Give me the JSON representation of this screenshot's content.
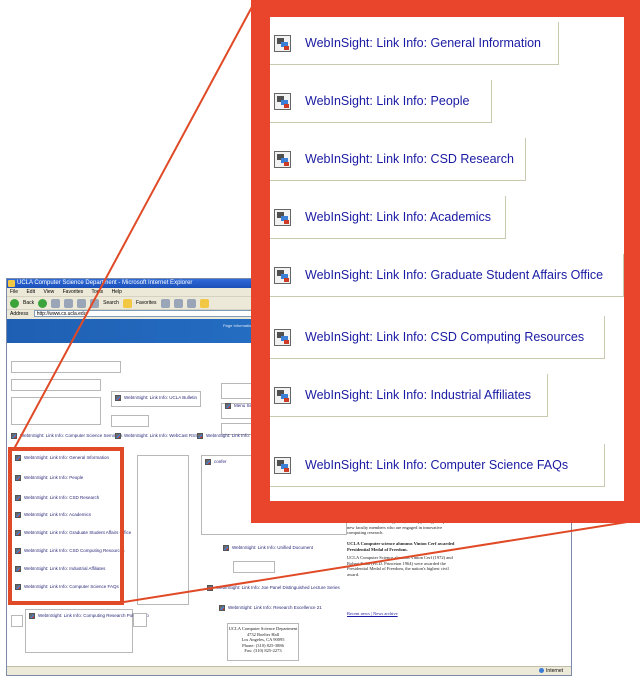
{
  "browser": {
    "title": "UCLA Computer Science Department - Microsoft Internet Explorer",
    "menu": [
      "File",
      "Edit",
      "View",
      "Favorites",
      "Tools",
      "Help"
    ],
    "toolbar": {
      "back": "Back",
      "search": "Search",
      "favorites": "Favorites"
    },
    "address_label": "Address",
    "address": "http://www.cs.ucla.edu/",
    "status_zone": "Internet"
  },
  "page": {
    "header_text": "Page Information / Global Site Information",
    "top_links": [
      "WebInSight: Link Info: UCLA Bulletin",
      "WebInSight: Link Info: Computer Science Seminars",
      "WebInSight: Link Info: WebCast RSS",
      "WebInSight: Link Info: CSD"
    ],
    "left_links": [
      "WebInSight: Link Info: General Information",
      "WebInSight: Link Info: People",
      "WebInSight: Link Info: CSD Research",
      "WebInSight: Link Info: Academics",
      "WebInSight: Link Info: Graduate Student Affairs Office",
      "WebInSight: Link Info: CSD Computing Resources",
      "WebInSight: Link Info: Industrial Affiliates",
      "WebInSight: Link Info: Computer Science FAQs"
    ],
    "bottom_link": "WebInSight: Link Info: Computing Research Policy Map",
    "center_links": [
      "WebInSight: Link Info: Unified Document",
      "WebInSight: Link Info: Joe Panel Distinguished Lecture Series",
      "WebInSight: Link Info: Research Excellence 21"
    ],
    "news_text": "Microsoft scientists, recognized, and supporting exceptional new faculty members who are engaged in innovative computing research.",
    "news_headline": "UCLA Computer science alumnus Vinton Cerf awarded Presidential Medal of Freedom.",
    "news_body": "UCLA Computer Science alumnus Vinton Cerf (1972) and Robert Kahn (Ph.D. Princeton 1964) were awarded the Presidential Medal of Freedom, the nation's highest civil award.",
    "news_links": "Recent news | News archive",
    "address_block": [
      "UCLA Computer Science Department",
      "4732 Boelter Hall",
      "Los Angeles, CA 90095",
      "Phone: (310) 825-3886",
      "Fax: (310) 825-2273"
    ],
    "misc_labels": [
      "Menu Search",
      "confer"
    ]
  },
  "zoom": {
    "links": [
      "WebInSight: Link Info: General Information",
      "WebInSight: Link Info: People",
      "WebInSight: Link Info: CSD Research",
      "WebInSight: Link Info: Academics",
      "WebInSight: Link Info: Graduate Student Affairs Office",
      "WebInSight: Link Info: CSD Computing Resources",
      "WebInSight: Link Info: Industrial Affiliates",
      "WebInSight: Link Info: Computer Science FAQs"
    ]
  },
  "colors": {
    "callout_red": "#e9442c",
    "link_blue": "#1a1aa3",
    "site_header": "#1f5fb3"
  }
}
